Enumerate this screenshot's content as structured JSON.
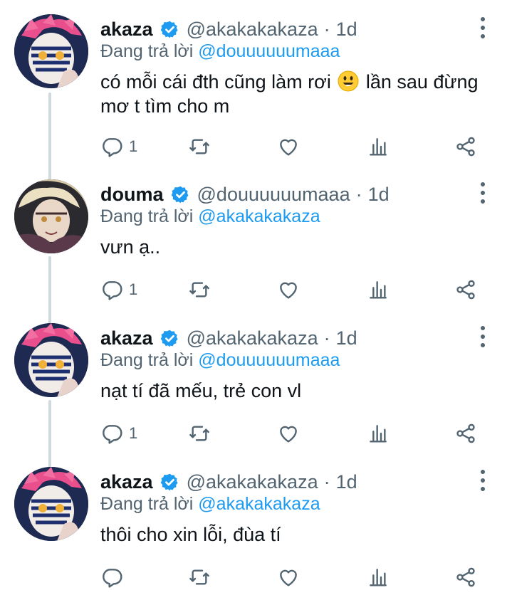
{
  "colors": {
    "accent": "#1d9bf0",
    "secondary_text": "#536471",
    "primary_text": "#0f1419",
    "thread_line": "#cfd9de"
  },
  "tweets": [
    {
      "name": "akaza",
      "handle": "@akakakakaza",
      "dot": "·",
      "time": "1d",
      "replying_prefix": "Đang trả lời",
      "replying_to": "@douuuuuumaaa",
      "text_before_emoji": "có mỗi cái đth cũng làm rơi",
      "emoji": "smiling-face-emoji",
      "text_after_emoji": "lần sau đừng mơ t tìm cho m",
      "reply_count": "1",
      "avatar": "akaza-avatar"
    },
    {
      "name": "douma",
      "handle": "@douuuuuumaaa",
      "dot": "·",
      "time": "1d",
      "replying_prefix": "Đang trả lời",
      "replying_to": "@akakakakaza",
      "text": "vưn ạ..",
      "reply_count": "1",
      "avatar": "douma-avatar"
    },
    {
      "name": "akaza",
      "handle": "@akakakakaza",
      "dot": "·",
      "time": "1d",
      "replying_prefix": "Đang trả lời",
      "replying_to": "@douuuuuumaaa",
      "text": "nạt tí đã mếu, trẻ con vl",
      "reply_count": "1",
      "avatar": "akaza-avatar"
    },
    {
      "name": "akaza",
      "handle": "@akakakakaza",
      "dot": "·",
      "time": "1d",
      "replying_prefix": "Đang trả lời",
      "replying_to": "@akakakakaza",
      "text": "thôi cho xin lỗi, đùa tí",
      "reply_count": "",
      "avatar": "akaza-avatar"
    }
  ],
  "icons": {
    "reply": "reply-icon",
    "retweet": "retweet-icon",
    "like": "heart-icon",
    "views": "bar-chart-icon",
    "share": "share-icon",
    "more": "more-vertical-icon",
    "verified": "verified-badge-icon"
  }
}
